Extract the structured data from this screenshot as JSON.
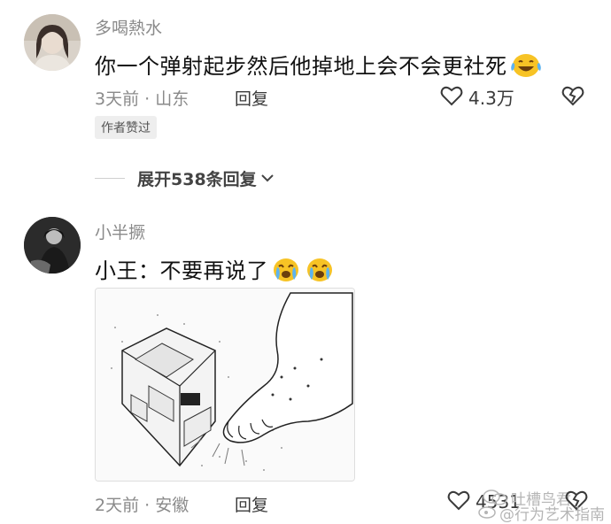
{
  "comments": [
    {
      "username": "多喝熱水",
      "text": "你一个弹射起步然后他掉地上会不会更社死",
      "emoji": "laughing-tears-emoji",
      "time": "3天前",
      "location": "山东",
      "separator": "·",
      "reply_label": "回复",
      "likes": "4.3万",
      "author_badge": "作者赞过",
      "expand_label": "展开538条回复"
    },
    {
      "username": "小半撅",
      "text": "小王：不要再说了",
      "emoji": "crying-laugh-emoji",
      "time": "2天前",
      "location": "安徽",
      "separator": "·",
      "reply_label": "回复",
      "likes": "4531"
    }
  ],
  "watermarks": {
    "account": "吐槽鸟君",
    "handle": "@行为艺术指南"
  },
  "colors": {
    "meta_gray": "#8a8a8a",
    "emoji_yellow": "#f7c325"
  }
}
